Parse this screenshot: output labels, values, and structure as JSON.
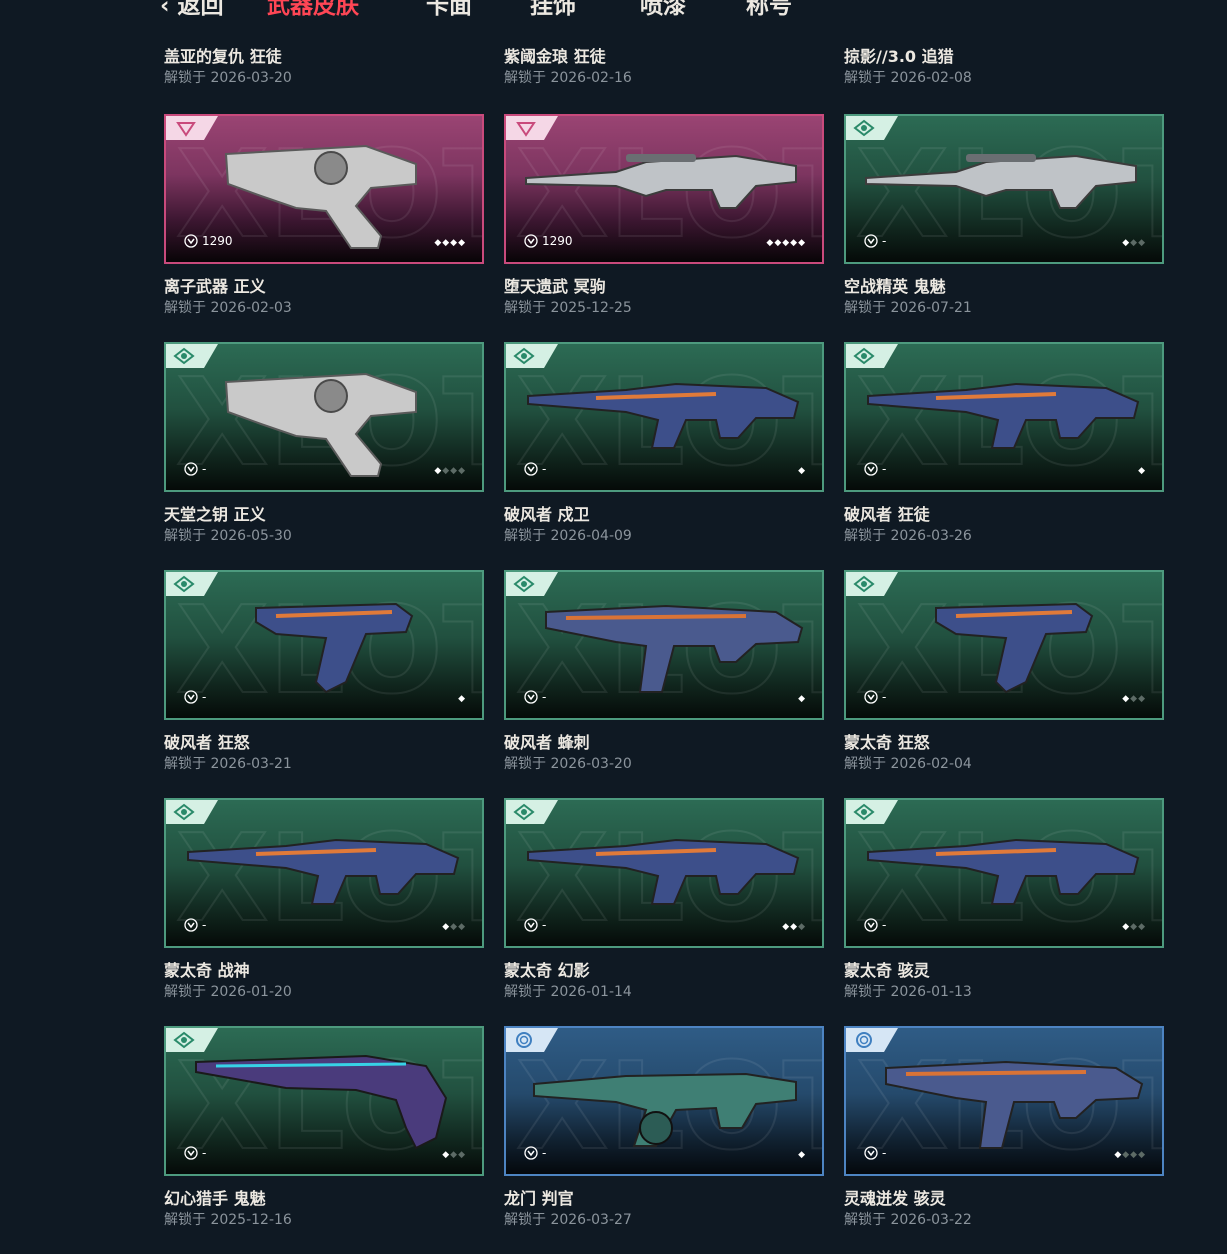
{
  "nav": {
    "back_label": "‹ 返回",
    "tabs": [
      {
        "label": "武器皮肤",
        "active": true
      },
      {
        "label": "卡面",
        "active": false
      },
      {
        "label": "挂饰",
        "active": false
      },
      {
        "label": "喷漆",
        "active": false
      },
      {
        "label": "称号",
        "active": false
      }
    ]
  },
  "colors": {
    "background": "#0f1923",
    "accent": "#ff4655",
    "tier_exclusive": "#c94a7c",
    "tier_deluxe": "#4d9a7e",
    "tier_premium": "#4d84c2"
  },
  "header_row": [
    {
      "name": "盖亚的复仇 狂徒",
      "unlock": "解锁于 2026-03-20"
    },
    {
      "name": "紫阈金琅 狂徒",
      "unlock": "解锁于 2026-02-16"
    },
    {
      "name": "掠影//3.0 追猎",
      "unlock": "解锁于 2026-02-08"
    }
  ],
  "cards": [
    {
      "tier": "exclusive",
      "price": "1290",
      "levels": 4,
      "levels_unlocked": 4,
      "gun_icon": "revolver-icon",
      "name": "离子武器 正义",
      "unlock": "解锁于 2026-02-03"
    },
    {
      "tier": "exclusive",
      "price": "1290",
      "levels": 5,
      "levels_unlocked": 5,
      "gun_icon": "sniper-rifle-icon",
      "name": "堕天遗武 冥驹",
      "unlock": "解锁于 2025-12-25"
    },
    {
      "tier": "deluxe",
      "price": "-",
      "levels": 3,
      "levels_unlocked": 1,
      "gun_icon": "sniper-rifle-icon",
      "name": "空战精英 鬼魅",
      "unlock": "解锁于 2026-07-21"
    },
    {
      "tier": "deluxe",
      "price": "-",
      "levels": 4,
      "levels_unlocked": 1,
      "gun_icon": "revolver-icon",
      "name": "天堂之钥 正义",
      "unlock": "解锁于 2026-05-30"
    },
    {
      "tier": "deluxe",
      "price": "-",
      "levels": 1,
      "levels_unlocked": 1,
      "gun_icon": "rifle-icon",
      "name": "破风者 戍卫",
      "unlock": "解锁于 2026-04-09"
    },
    {
      "tier": "deluxe",
      "price": "-",
      "levels": 1,
      "levels_unlocked": 1,
      "gun_icon": "rifle-icon",
      "name": "破风者 狂徒",
      "unlock": "解锁于 2026-03-26"
    },
    {
      "tier": "deluxe",
      "price": "-",
      "levels": 1,
      "levels_unlocked": 1,
      "gun_icon": "pistol-icon",
      "name": "破风者 狂怒",
      "unlock": "解锁于 2026-03-21"
    },
    {
      "tier": "deluxe",
      "price": "-",
      "levels": 1,
      "levels_unlocked": 1,
      "gun_icon": "smg-icon",
      "name": "破风者 蜂刺",
      "unlock": "解锁于 2026-03-20"
    },
    {
      "tier": "deluxe",
      "price": "-",
      "levels": 3,
      "levels_unlocked": 1,
      "gun_icon": "pistol-icon",
      "name": "蒙太奇 狂怒",
      "unlock": "解锁于 2026-02-04"
    },
    {
      "tier": "deluxe",
      "price": "-",
      "levels": 3,
      "levels_unlocked": 1,
      "gun_icon": "rifle-icon",
      "name": "蒙太奇 战神",
      "unlock": "解锁于 2026-01-20"
    },
    {
      "tier": "deluxe",
      "price": "-",
      "levels": 3,
      "levels_unlocked": 2,
      "gun_icon": "rifle-icon",
      "name": "蒙太奇 幻影",
      "unlock": "解锁于 2026-01-14"
    },
    {
      "tier": "deluxe",
      "price": "-",
      "levels": 3,
      "levels_unlocked": 1,
      "gun_icon": "rifle-icon",
      "name": "蒙太奇 骇灵",
      "unlock": "解锁于 2026-01-13"
    },
    {
      "tier": "deluxe",
      "price": "-",
      "levels": 3,
      "levels_unlocked": 1,
      "gun_icon": "knife-icon",
      "name": "幻心猎手 鬼魅",
      "unlock": "解锁于 2025-12-16"
    },
    {
      "tier": "premium",
      "price": "-",
      "levels": 1,
      "levels_unlocked": 1,
      "gun_icon": "shotgun-icon",
      "name": "龙门 判官",
      "unlock": "解锁于 2026-03-27"
    },
    {
      "tier": "premium",
      "price": "-",
      "levels": 4,
      "levels_unlocked": 1,
      "gun_icon": "smg-icon",
      "name": "灵魂迸发 骇灵",
      "unlock": "解锁于 2026-03-22"
    }
  ]
}
